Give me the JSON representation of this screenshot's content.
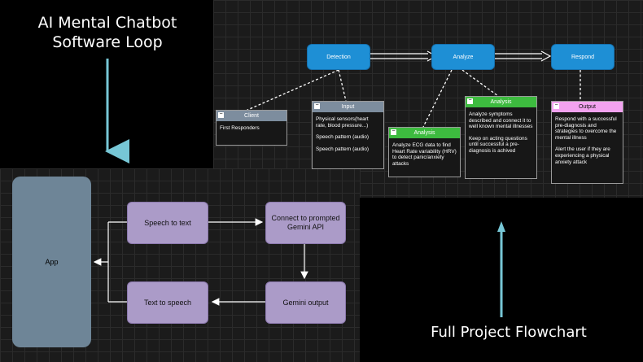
{
  "main_title": [
    "AI Mental Chatbot",
    "Software Loop"
  ],
  "footer_title": "Full Project Flowchart",
  "project_flow": {
    "detection": "Detection",
    "analyze": "Analyze",
    "respond": "Respond",
    "client": {
      "title": "Client",
      "lines": [
        "First Responders"
      ]
    },
    "input": {
      "title": "Input",
      "lines": [
        "Physical sensors(heart rate, blood pressure...)",
        "Speech pattern (audio)",
        "Speech pattern (audio)"
      ]
    },
    "analysis_ecg": {
      "title": "Analysis",
      "lines": [
        "Analyze ECG data to find Heart Rate variability (HRV) to detect panic/anxiety attacks"
      ]
    },
    "analysis_symptoms": {
      "title": "Analysis",
      "lines": [
        "Analyze symptoms described and connect it to well known mental illnesses",
        "Keep on acting questions until successful a pre-diagnosis is achived"
      ]
    },
    "output": {
      "title": "Output",
      "lines": [
        "Respond with a successful pre-diagnosis and strategies to overcome the mental illness",
        "Alert the user if they are experiencing a physical anxiety attack"
      ]
    }
  },
  "software_loop": {
    "app": "App",
    "speech_to_text": "Speech to text",
    "connect_gemini": "Connect to prompted Gemini API",
    "gemini_output": "Gemini output",
    "text_to_speech": "Text to speech"
  },
  "colors": {
    "blue": "#1e8fd5",
    "green": "#3dbb3f",
    "pink": "#f2a2ef",
    "slate_header": "#7d8d9e",
    "purple": "#ab9bc8",
    "app": "#6e8597",
    "arrow_cyan": "#77c7d6"
  }
}
